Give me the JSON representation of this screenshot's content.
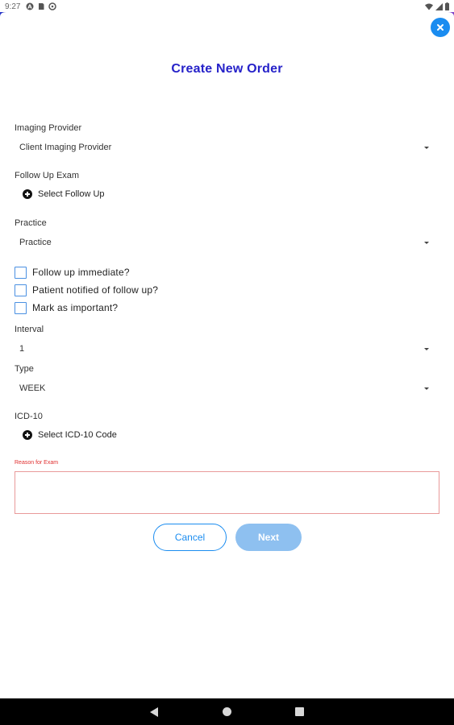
{
  "status_bar": {
    "time": "9:27",
    "left_icons": [
      "a-circle-icon",
      "sim-icon",
      "data-saver-icon"
    ],
    "right_icons": [
      "wifi-icon",
      "signal-icon",
      "battery-icon"
    ]
  },
  "header": {
    "title": "Create New Order",
    "close_icon": "close-icon"
  },
  "form": {
    "imaging_provider": {
      "label": "Imaging Provider",
      "value": "Client Imaging Provider"
    },
    "follow_up_exam": {
      "label": "Follow Up Exam",
      "action": "Select Follow Up"
    },
    "practice": {
      "label": "Practice",
      "value": "Practice"
    },
    "checkboxes": [
      {
        "label": "Follow up immediate?",
        "checked": false
      },
      {
        "label": "Patient notified of follow up?",
        "checked": false
      },
      {
        "label": "Mark as important?",
        "checked": false
      }
    ],
    "interval": {
      "label": "Interval",
      "value": "1"
    },
    "type": {
      "label": "Type",
      "value": "WEEK"
    },
    "icd10": {
      "label": "ICD-10",
      "action": "Select ICD-10 Code"
    },
    "reason": {
      "label": "Reason for Exam",
      "value": ""
    }
  },
  "buttons": {
    "cancel": "Cancel",
    "next": "Next"
  },
  "colors": {
    "title": "#2622c9",
    "accent": "#1a8cf0",
    "next_disabled": "#8ec0f0",
    "error": "#e03030"
  }
}
